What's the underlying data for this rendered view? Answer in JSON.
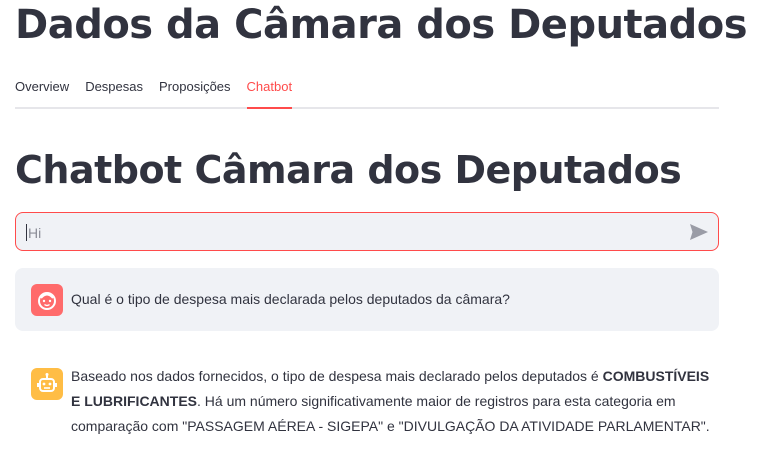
{
  "app": {
    "title": "Dados da Câmara dos Deputados"
  },
  "tabs": [
    {
      "label": "Overview",
      "active": false
    },
    {
      "label": "Despesas",
      "active": false
    },
    {
      "label": "Proposições",
      "active": false
    },
    {
      "label": "Chatbot",
      "active": true
    }
  ],
  "page": {
    "title": "Chatbot Câmara dos Deputados"
  },
  "chat_input": {
    "value": "",
    "placeholder": "Hi",
    "send_icon": "send-icon"
  },
  "messages": {
    "user": {
      "avatar_icon": "user-face-icon",
      "text": "Qual é o tipo de despesa mais declarada pelos deputados da câmara?"
    },
    "bot": {
      "avatar_icon": "robot-icon",
      "text_before": "Baseado nos dados fornecidos, o tipo de despesa mais declarado pelos deputados é ",
      "text_bold": "COMBUSTÍVEIS E LUBRIFICANTES",
      "text_after": ". Há um número significativamente maior de registros para esta categoria em comparação com \"PASSAGEM AÉREA - SIGEPA\" e \"DIVULGAÇÃO DA ATIVIDADE PARLAMENTAR\"."
    }
  },
  "colors": {
    "accent": "#ff4b4b",
    "user_avatar": "#ff6b6b",
    "bot_avatar": "#ffbd45",
    "bubble_bg": "#f0f2f6"
  }
}
